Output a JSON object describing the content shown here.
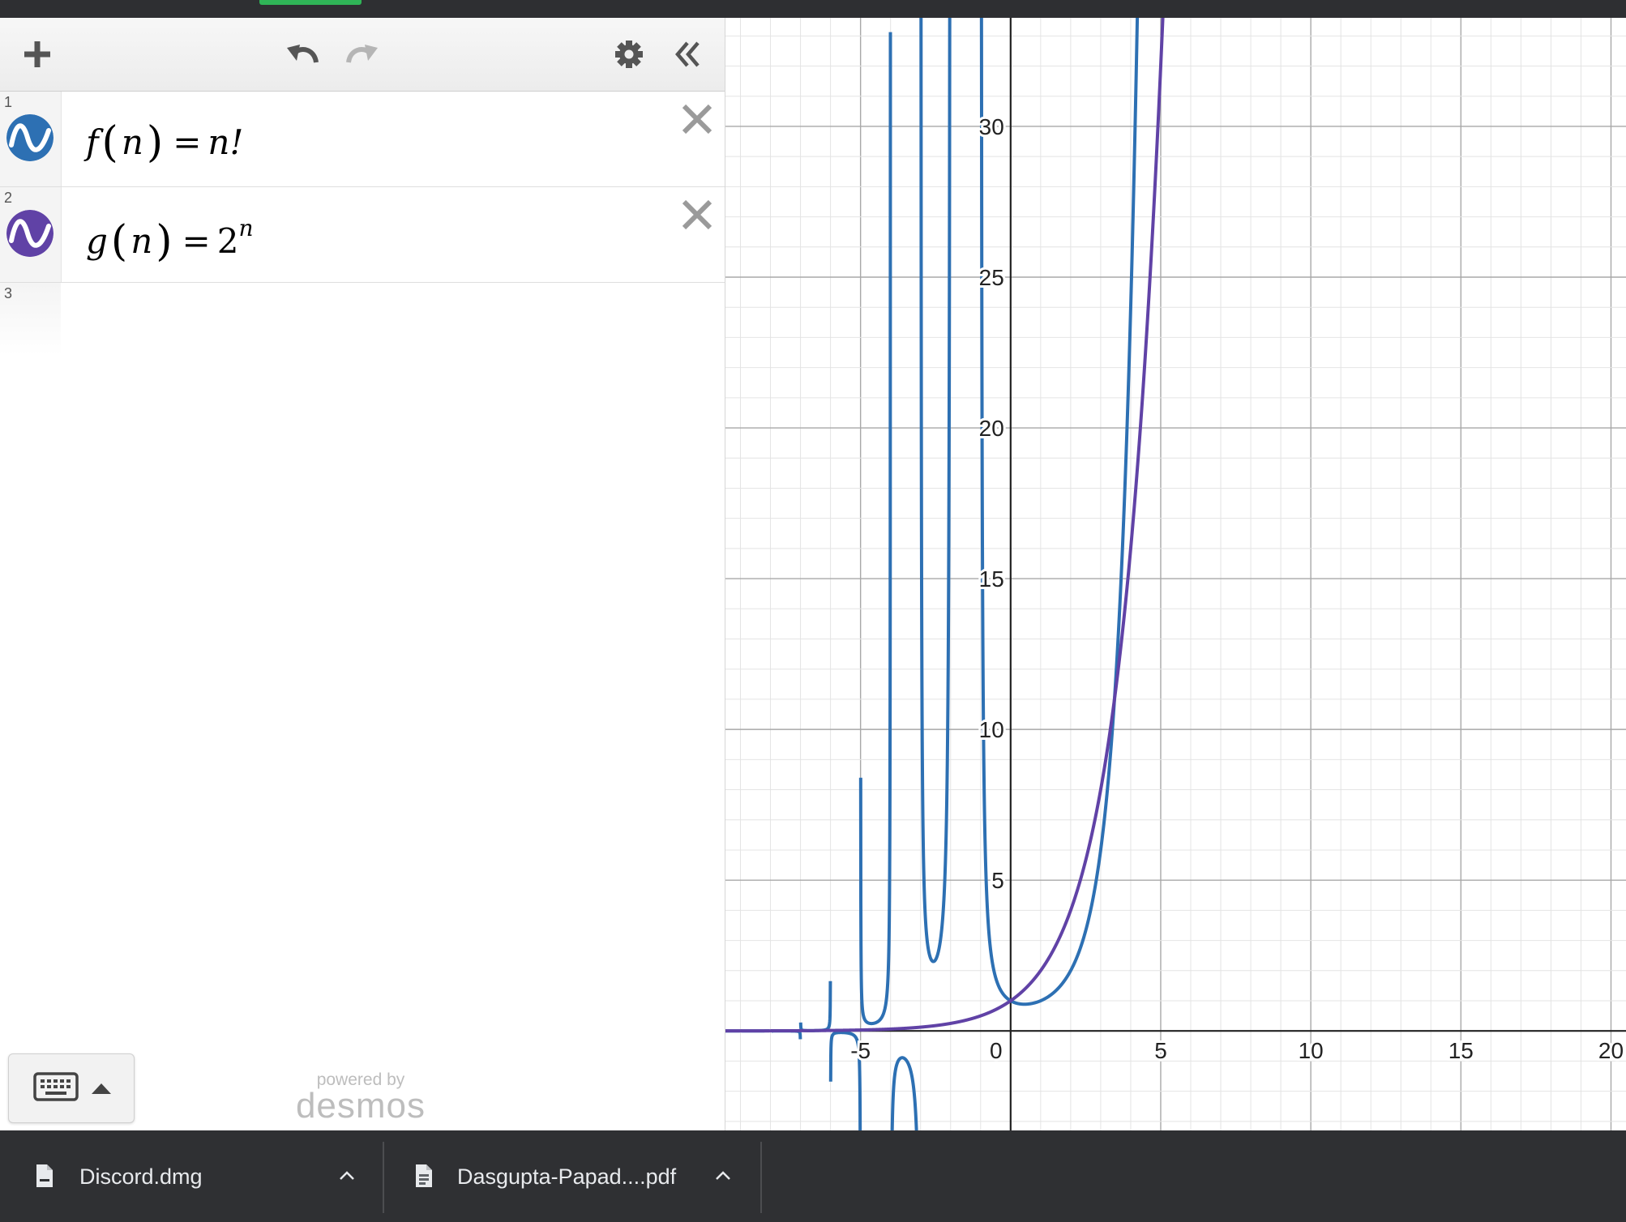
{
  "toolbar": {
    "add_icon": "plus-icon",
    "undo_icon": "undo-icon",
    "redo_icon": "redo-icon",
    "settings_icon": "gear-icon",
    "collapse_icon": "double-chevron-left-icon"
  },
  "expressions": [
    {
      "number": "1",
      "label": "f(n) = n!",
      "color": "#2d70b3"
    },
    {
      "number": "2",
      "label": "g(n) = 2^n",
      "color": "#6042a6"
    },
    {
      "number": "3",
      "label": ""
    }
  ],
  "expr1": {
    "func": "f",
    "arg": "n",
    "rhs": "n!"
  },
  "expr2": {
    "func": "g",
    "arg": "n",
    "base": "2",
    "exponent": "n"
  },
  "branding": {
    "line1": "powered by",
    "line2": "desmos"
  },
  "keypad_button": {
    "icons": [
      "keyboard-icon",
      "triangle-up-icon"
    ]
  },
  "chart_data": {
    "type": "line",
    "title": "",
    "xlabel": "",
    "ylabel": "",
    "xlim": [
      -9.5,
      20.5
    ],
    "ylim": [
      -3.3,
      33.6
    ],
    "grid": true,
    "x_ticks": [
      "-5",
      "0",
      "5",
      "10",
      "15",
      "20"
    ],
    "y_ticks": [
      "5",
      "10",
      "15",
      "20",
      "25",
      "30"
    ],
    "series": [
      {
        "name": "f(n) = n!",
        "color": "#2d70b3",
        "function": "gamma(n+1)",
        "points": [
          [
            0,
            1
          ],
          [
            1,
            1
          ],
          [
            2,
            2
          ],
          [
            3,
            6
          ],
          [
            4,
            24
          ]
        ]
      },
      {
        "name": "g(n) = 2^n",
        "color": "#6042a6",
        "function": "2^n",
        "points": [
          [
            0,
            1
          ],
          [
            1,
            2
          ],
          [
            2,
            4
          ],
          [
            3,
            8
          ],
          [
            4,
            16
          ],
          [
            5,
            32
          ]
        ]
      }
    ]
  },
  "downloads": [
    {
      "name": "Discord.dmg",
      "icon": "file-icon"
    },
    {
      "name": "Dasgupta-Papad....pdf",
      "icon": "pdf-file-icon"
    }
  ]
}
